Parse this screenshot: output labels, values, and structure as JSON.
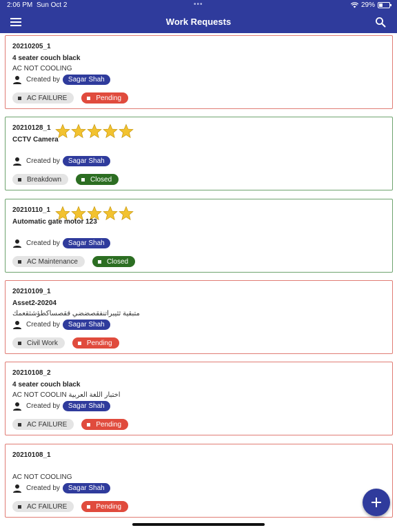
{
  "status_bar": {
    "time": "2:06 PM",
    "date": "Sun Oct 2",
    "battery": "29%",
    "battery_level": 0.29,
    "dots": "•••"
  },
  "header": {
    "title": "Work Requests"
  },
  "icons": {
    "menu": "hamburger-menu-icon",
    "search": "search-icon",
    "person": "person-icon",
    "star": "star-icon",
    "add": "plus-icon"
  },
  "colors": {
    "primary": "#2f3b9c",
    "pending": "#e04b3d",
    "closed": "#2c6e22",
    "star": "#f2c230"
  },
  "created_by_label": "Created by",
  "requests": [
    {
      "id": "20210205_1",
      "asset": "4 seater couch black",
      "description": "AC NOT COOLING",
      "created_by": "Sagar Shah",
      "category": "AC FAILURE",
      "status": "Pending",
      "rating": null
    },
    {
      "id": "20210128_1",
      "asset": "CCTV Camera",
      "description": "",
      "created_by": "Sagar Shah",
      "category": "Breakdown",
      "status": "Closed",
      "rating": 5
    },
    {
      "id": "20210110_1",
      "asset": "Automatic gate motor 123",
      "description": "",
      "created_by": "Sagar Shah",
      "category": "AC Maintenance",
      "status": "Closed",
      "rating": 5
    },
    {
      "id": "20210109_1",
      "asset": "Asset2-20204",
      "description": "متبقية   ثثيبراتنفقصضضي   ققصساكطؤشثقعمك",
      "created_by": "Sagar Shah",
      "category": "Civil Work",
      "status": "Pending",
      "rating": null
    },
    {
      "id": "20210108_2",
      "asset": "4 seater couch black",
      "description": "AC NOT COOLIN اختبار اللغة العربية",
      "created_by": "Sagar Shah",
      "category": "AC FAILURE",
      "status": "Pending",
      "rating": null
    },
    {
      "id": "20210108_1",
      "asset": "",
      "description": "AC NOT COOLING",
      "created_by": "Sagar Shah",
      "category": "AC FAILURE",
      "status": "Pending",
      "rating": null
    }
  ]
}
